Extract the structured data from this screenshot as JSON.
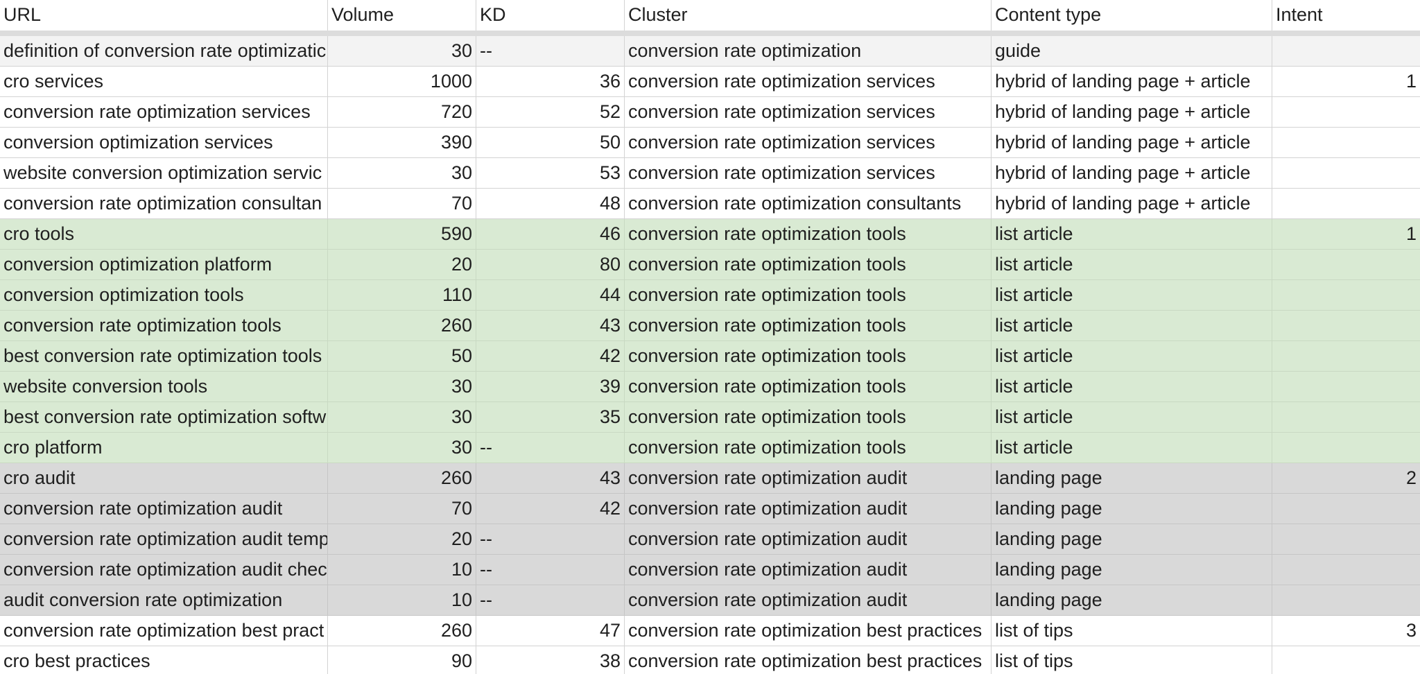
{
  "headers": {
    "url": "URL",
    "volume": "Volume",
    "kd": "KD",
    "cluster": "Cluster",
    "content_type": "Content type",
    "intent": "Intent"
  },
  "rows": [
    {
      "url": "definition of conversion rate optimizatic",
      "volume": "30",
      "kd": "--",
      "cluster": "conversion rate optimization",
      "content_type": "guide",
      "intent": "",
      "group": "gray"
    },
    {
      "url": "cro services",
      "volume": "1000",
      "kd": "36",
      "cluster": "conversion rate optimization services",
      "content_type": "hybrid of landing page + article",
      "intent": "1",
      "group": "white"
    },
    {
      "url": "conversion rate optimization services",
      "volume": "720",
      "kd": "52",
      "cluster": "conversion rate optimization services",
      "content_type": "hybrid of landing page + article",
      "intent": "",
      "group": "white"
    },
    {
      "url": "conversion optimization services",
      "volume": "390",
      "kd": "50",
      "cluster": "conversion rate optimization services",
      "content_type": "hybrid of landing page + article",
      "intent": "",
      "group": "white"
    },
    {
      "url": "website conversion optimization servic",
      "volume": "30",
      "kd": "53",
      "cluster": "conversion rate optimization services",
      "content_type": "hybrid of landing page + article",
      "intent": "",
      "group": "white"
    },
    {
      "url": "conversion rate optimization consultan",
      "volume": "70",
      "kd": "48",
      "cluster": "conversion rate optimization consultants",
      "content_type": "hybrid of landing page + article",
      "intent": "",
      "group": "white"
    },
    {
      "url": "cro tools",
      "volume": "590",
      "kd": "46",
      "cluster": "conversion rate optimization tools",
      "content_type": "list article",
      "intent": "1",
      "group": "green"
    },
    {
      "url": "conversion optimization platform",
      "volume": "20",
      "kd": "80",
      "cluster": "conversion rate optimization tools",
      "content_type": "list article",
      "intent": "",
      "group": "green"
    },
    {
      "url": "conversion optimization tools",
      "volume": "110",
      "kd": "44",
      "cluster": "conversion rate optimization tools",
      "content_type": "list article",
      "intent": "",
      "group": "green"
    },
    {
      "url": "conversion rate optimization tools",
      "volume": "260",
      "kd": "43",
      "cluster": "conversion rate optimization tools",
      "content_type": "list article",
      "intent": "",
      "group": "green"
    },
    {
      "url": "best conversion rate optimization tools",
      "volume": "50",
      "kd": "42",
      "cluster": "conversion rate optimization tools",
      "content_type": "list article",
      "intent": "",
      "group": "green"
    },
    {
      "url": "website conversion tools",
      "volume": "30",
      "kd": "39",
      "cluster": "conversion rate optimization tools",
      "content_type": "list article",
      "intent": "",
      "group": "green"
    },
    {
      "url": "best conversion rate optimization softw",
      "volume": "30",
      "kd": "35",
      "cluster": "conversion rate optimization tools",
      "content_type": "list article",
      "intent": "",
      "group": "green"
    },
    {
      "url": "cro platform",
      "volume": "30",
      "kd": "--",
      "cluster": "conversion rate optimization tools",
      "content_type": "list article",
      "intent": "",
      "group": "green"
    },
    {
      "url": "cro audit",
      "volume": "260",
      "kd": "43",
      "cluster": "conversion rate optimization audit",
      "content_type": "landing page",
      "intent": "2",
      "group": "grey2"
    },
    {
      "url": "conversion rate optimization audit",
      "volume": "70",
      "kd": "42",
      "cluster": "conversion rate optimization audit",
      "content_type": "landing page",
      "intent": "",
      "group": "grey2"
    },
    {
      "url": "conversion rate optimization audit temp",
      "volume": "20",
      "kd": "--",
      "cluster": "conversion rate optimization audit",
      "content_type": "landing page",
      "intent": "",
      "group": "grey2"
    },
    {
      "url": "conversion rate optimization audit chec",
      "volume": "10",
      "kd": "--",
      "cluster": "conversion rate optimization audit",
      "content_type": "landing page",
      "intent": "",
      "group": "grey2"
    },
    {
      "url": "audit conversion rate optimization",
      "volume": "10",
      "kd": "--",
      "cluster": "conversion rate optimization audit",
      "content_type": "landing page",
      "intent": "",
      "group": "grey2"
    },
    {
      "url": "conversion rate optimization best pract",
      "volume": "260",
      "kd": "47",
      "cluster": "conversion rate optimization best practices",
      "content_type": "list of tips",
      "intent": "3",
      "group": "white"
    },
    {
      "url": "cro best practices",
      "volume": "90",
      "kd": "38",
      "cluster": "conversion rate optimization best practices",
      "content_type": "list of tips",
      "intent": "",
      "group": "white"
    }
  ]
}
